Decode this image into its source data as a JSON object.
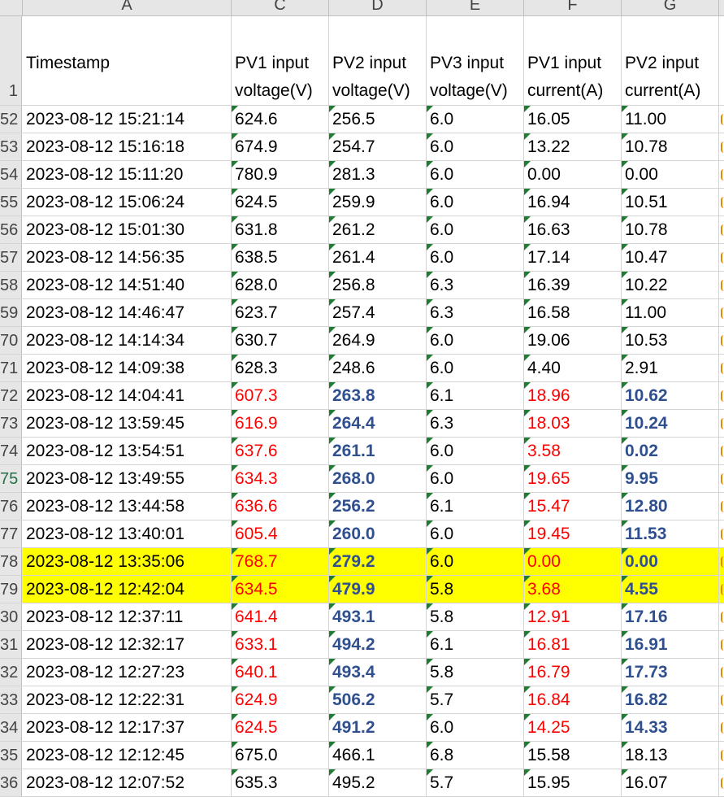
{
  "column_letters": [
    "A",
    "C",
    "D",
    "E",
    "F",
    "G"
  ],
  "header": {
    "row_number": "1",
    "timestamp": "Timestamp",
    "pv1_voltage": "PV1 input voltage(V)",
    "pv2_voltage": "PV2 input voltage(V)",
    "pv3_voltage": "PV3 input voltage(V)",
    "pv1_current": "PV1 input current(A)",
    "pv2_current": "PV2 input current(A)"
  },
  "colors": {
    "highlight": "#ffff00",
    "red_text": "#ff0000",
    "blue_text": "#2f4f8f",
    "error_triangle": "#1e7d32"
  },
  "rows": [
    {
      "num": "52",
      "ts": "2023-08-12 15:21:14",
      "c": "624.6",
      "d": "256.5",
      "e": "6.0",
      "f": "16.05",
      "g": "11.00"
    },
    {
      "num": "53",
      "ts": "2023-08-12 15:16:18",
      "c": "674.9",
      "d": "254.7",
      "e": "6.0",
      "f": "13.22",
      "g": "10.78"
    },
    {
      "num": "54",
      "ts": "2023-08-12 15:11:20",
      "c": "780.9",
      "d": "281.3",
      "e": "6.0",
      "f": "0.00",
      "g": "0.00"
    },
    {
      "num": "55",
      "ts": "2023-08-12 15:06:24",
      "c": "624.5",
      "d": "259.9",
      "e": "6.0",
      "f": "16.94",
      "g": "10.51"
    },
    {
      "num": "56",
      "ts": "2023-08-12 15:01:30",
      "c": "631.8",
      "d": "261.2",
      "e": "6.0",
      "f": "16.63",
      "g": "10.78"
    },
    {
      "num": "57",
      "ts": "2023-08-12 14:56:35",
      "c": "638.5",
      "d": "261.4",
      "e": "6.0",
      "f": "17.14",
      "g": "10.47"
    },
    {
      "num": "58",
      "ts": "2023-08-12 14:51:40",
      "c": "628.0",
      "d": "256.8",
      "e": "6.3",
      "f": "16.39",
      "g": "10.22"
    },
    {
      "num": "59",
      "ts": "2023-08-12 14:46:47",
      "c": "623.7",
      "d": "257.4",
      "e": "6.3",
      "f": "16.58",
      "g": "11.00"
    },
    {
      "num": "70",
      "ts": "2023-08-12 14:14:34",
      "c": "630.7",
      "d": "264.9",
      "e": "6.0",
      "f": "19.06",
      "g": "10.53"
    },
    {
      "num": "71",
      "ts": "2023-08-12 14:09:38",
      "c": "628.3",
      "d": "248.6",
      "e": "6.0",
      "f": "4.40",
      "g": "2.91"
    },
    {
      "num": "72",
      "ts": "2023-08-12 14:04:41",
      "c": "607.3",
      "d": "263.8",
      "e": "6.1",
      "f": "18.96",
      "g": "10.62",
      "styled": true
    },
    {
      "num": "73",
      "ts": "2023-08-12 13:59:45",
      "c": "616.9",
      "d": "264.4",
      "e": "6.3",
      "f": "18.03",
      "g": "10.24",
      "styled": true
    },
    {
      "num": "74",
      "ts": "2023-08-12 13:54:51",
      "c": "637.6",
      "d": "261.1",
      "e": "6.0",
      "f": "3.58",
      "g": "0.02",
      "styled": true
    },
    {
      "num": "75",
      "ts": "2023-08-12 13:49:55",
      "c": "634.3",
      "d": "268.0",
      "e": "6.0",
      "f": "19.65",
      "g": "9.95",
      "styled": true,
      "selected": true
    },
    {
      "num": "76",
      "ts": "2023-08-12 13:44:58",
      "c": "636.6",
      "d": "256.2",
      "e": "6.1",
      "f": "15.47",
      "g": "12.80",
      "styled": true
    },
    {
      "num": "77",
      "ts": "2023-08-12 13:40:01",
      "c": "605.4",
      "d": "260.0",
      "e": "6.0",
      "f": "19.45",
      "g": "11.53",
      "styled": true
    },
    {
      "num": "78",
      "ts": "2023-08-12 13:35:06",
      "c": "768.7",
      "d": "279.2",
      "e": "6.0",
      "f": "0.00",
      "g": "0.00",
      "styled": true,
      "highlight": true
    },
    {
      "num": "79",
      "ts": "2023-08-12 12:42:04",
      "c": "634.5",
      "d": "479.9",
      "e": "5.8",
      "f": "3.68",
      "g": "4.55",
      "styled": true,
      "highlight": true
    },
    {
      "num": "30",
      "ts": "2023-08-12 12:37:11",
      "c": "641.4",
      "d": "493.1",
      "e": "5.8",
      "f": "12.91",
      "g": "17.16",
      "styled": true
    },
    {
      "num": "31",
      "ts": "2023-08-12 12:32:17",
      "c": "633.1",
      "d": "494.2",
      "e": "6.1",
      "f": "16.81",
      "g": "16.91",
      "styled": true
    },
    {
      "num": "32",
      "ts": "2023-08-12 12:27:23",
      "c": "640.1",
      "d": "493.4",
      "e": "5.8",
      "f": "16.79",
      "g": "17.73",
      "styled": true
    },
    {
      "num": "33",
      "ts": "2023-08-12 12:22:31",
      "c": "624.9",
      "d": "506.2",
      "e": "5.7",
      "f": "16.84",
      "g": "16.82",
      "styled": true
    },
    {
      "num": "34",
      "ts": "2023-08-12 12:17:37",
      "c": "624.5",
      "d": "491.2",
      "e": "6.0",
      "f": "14.25",
      "g": "14.33",
      "styled": true
    },
    {
      "num": "35",
      "ts": "2023-08-12 12:12:45",
      "c": "675.0",
      "d": "466.1",
      "e": "6.8",
      "f": "15.58",
      "g": "18.13"
    },
    {
      "num": "36",
      "ts": "2023-08-12 12:07:52",
      "c": "635.3",
      "d": "495.2",
      "e": "5.7",
      "f": "15.95",
      "g": "16.07"
    }
  ]
}
